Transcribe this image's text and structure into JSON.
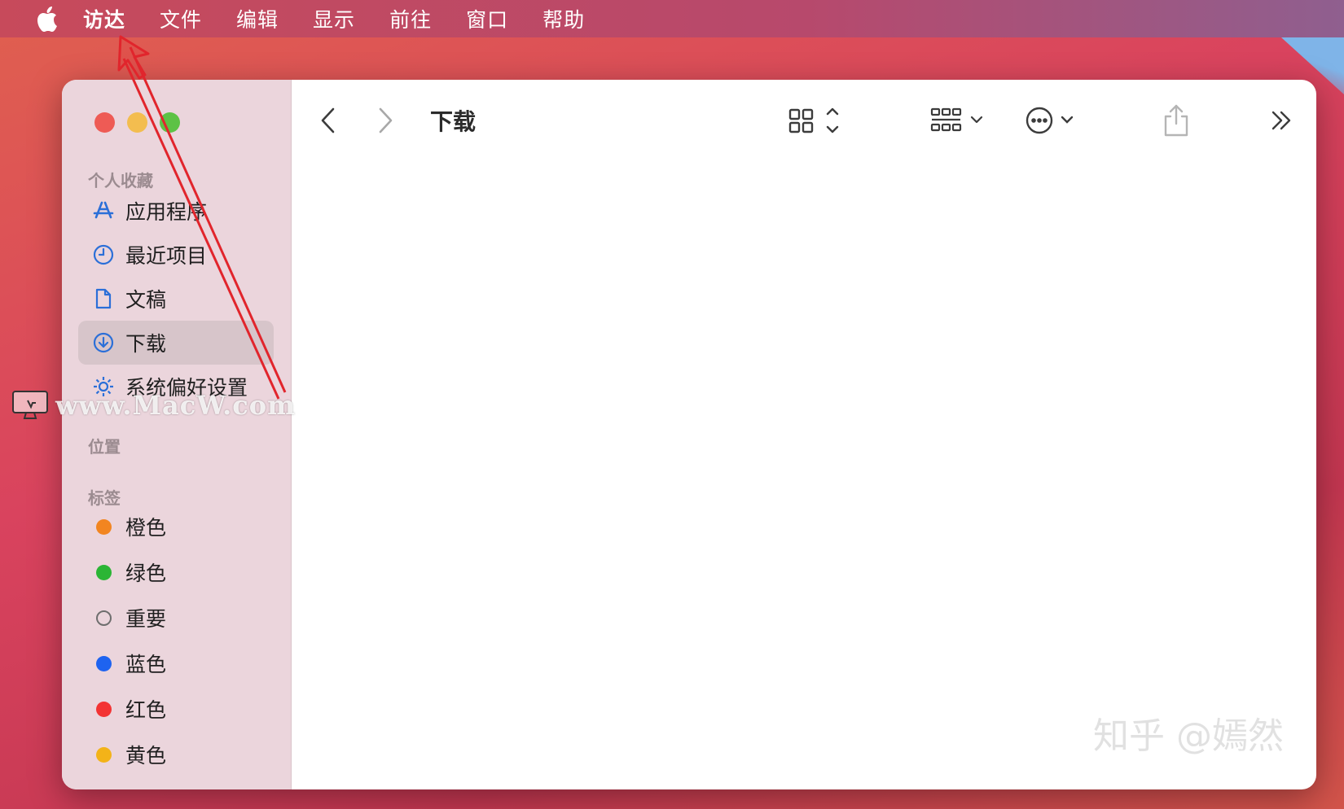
{
  "menubar": {
    "items": [
      {
        "label": "访达"
      },
      {
        "label": "文件"
      },
      {
        "label": "编辑"
      },
      {
        "label": "显示"
      },
      {
        "label": "前往"
      },
      {
        "label": "窗口"
      },
      {
        "label": "帮助"
      }
    ]
  },
  "sidebar": {
    "favorites_header": "个人收藏",
    "favorites": [
      {
        "label": "应用程序",
        "icon": "app-store-icon"
      },
      {
        "label": "最近项目",
        "icon": "clock-icon"
      },
      {
        "label": "文稿",
        "icon": "document-icon"
      },
      {
        "label": "下载",
        "icon": "download-icon",
        "selected": true
      },
      {
        "label": "系统偏好设置",
        "icon": "gear-icon"
      }
    ],
    "locations_header": "位置",
    "tags_header": "标签",
    "tags": [
      {
        "label": "橙色",
        "color": "#f28520"
      },
      {
        "label": "绿色",
        "color": "#2bb535"
      },
      {
        "label": "重要",
        "color": "hollow"
      },
      {
        "label": "蓝色",
        "color": "#1e63f0"
      },
      {
        "label": "红色",
        "color": "#f33333"
      },
      {
        "label": "黄色",
        "color": "#f3b318"
      }
    ]
  },
  "toolbar": {
    "title": "下载"
  },
  "watermarks": {
    "macw": "www.MacW.com",
    "zhihu": "知乎 @嫣然"
  },
  "colors": {
    "accent": "#2b6fd8",
    "arrow": "#e1252c"
  }
}
